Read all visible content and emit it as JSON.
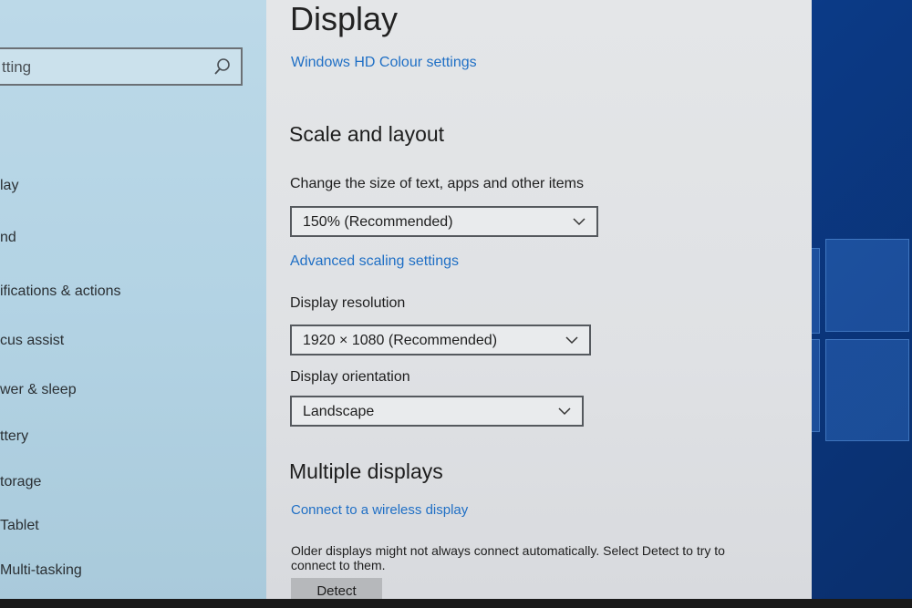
{
  "sidebar": {
    "search_text": "tting",
    "items": [
      {
        "label": "lay"
      },
      {
        "label": "nd"
      },
      {
        "label": "ifications & actions"
      },
      {
        "label": "cus assist"
      },
      {
        "label": "wer & sleep"
      },
      {
        "label": "ttery"
      },
      {
        "label": "torage"
      },
      {
        "label": "Tablet"
      },
      {
        "label": "Multi-tasking"
      }
    ]
  },
  "main": {
    "title": "Display",
    "hd_colour_link": "Windows HD Colour settings",
    "scale_layout": {
      "heading": "Scale and layout",
      "size_label": "Change the size of text, apps and other items",
      "size_value": "150% (Recommended)",
      "advanced_link": "Advanced scaling settings",
      "resolution_label": "Display resolution",
      "resolution_value": "1920 × 1080 (Recommended)",
      "orientation_label": "Display orientation",
      "orientation_value": "Landscape"
    },
    "multiple_displays": {
      "heading": "Multiple displays",
      "wireless_link": "Connect to a wireless display",
      "description": "Older displays might not always connect automatically. Select Detect to try to connect to them.",
      "detect_button": "Detect"
    }
  },
  "colors": {
    "link": "#1f6fc5",
    "sidebar_bg": "#b3d3e4",
    "content_bg": "#e0e2e5",
    "desktop_blue": "#1d5fc0"
  }
}
